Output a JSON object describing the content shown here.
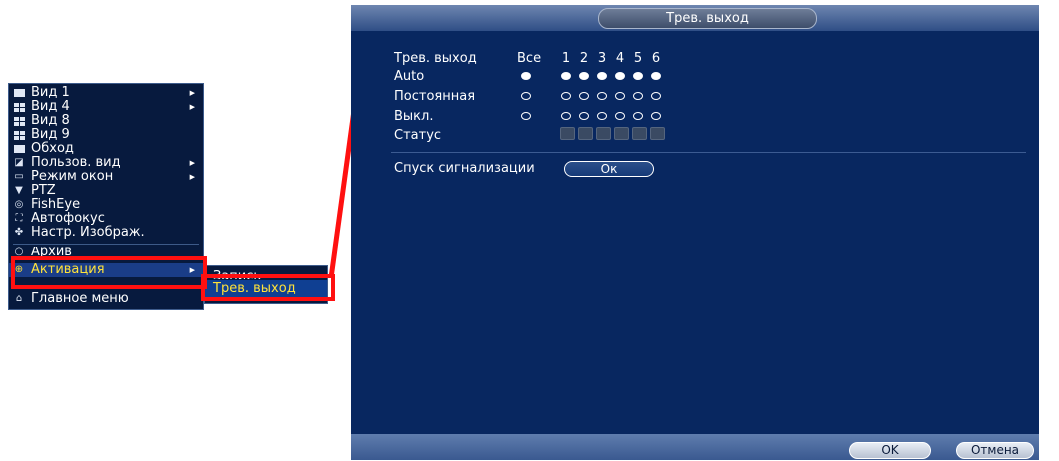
{
  "menu": {
    "items": [
      {
        "label": "Вид 1",
        "icon": "square-icon",
        "arrow": true
      },
      {
        "label": "Вид 4",
        "icon": "grid-4-icon",
        "arrow": true
      },
      {
        "label": "Вид 8",
        "icon": "grid-8-icon",
        "arrow": false
      },
      {
        "label": "Вид 9",
        "icon": "grid-9-icon",
        "arrow": false
      },
      {
        "label": "Обход",
        "icon": "tour-icon",
        "arrow": false
      },
      {
        "label": "Пользов. вид",
        "icon": "custom-view-icon",
        "arrow": true
      },
      {
        "label": "Режим окон",
        "icon": "monitor-icon",
        "arrow": true
      },
      {
        "label": "PTZ",
        "icon": "ptz-icon",
        "arrow": false
      },
      {
        "label": "FishEye",
        "icon": "fisheye-icon",
        "arrow": false
      },
      {
        "label": "Автофокус",
        "icon": "autofocus-icon",
        "arrow": false
      },
      {
        "label": "Настр. Изображ.",
        "icon": "image-settings-icon",
        "arrow": false
      },
      {
        "label": "Архив",
        "icon": "search-icon",
        "arrow": false
      },
      {
        "label": "Активация",
        "icon": "activation-icon",
        "arrow": true
      },
      {
        "label": "Главное меню",
        "icon": "home-icon",
        "arrow": false
      }
    ],
    "highlight_color": "#ffe23a"
  },
  "submenu": {
    "items": [
      "Запись",
      "Трев. выход"
    ],
    "selected": "Трев. выход"
  },
  "dialog": {
    "title": "Трев. выход",
    "header_label": "Трев. выход",
    "all_label": "Все",
    "channels": [
      "1",
      "2",
      "3",
      "4",
      "5",
      "6"
    ],
    "rows": [
      {
        "label": "Auto",
        "all_on": true,
        "states": [
          true,
          true,
          true,
          true,
          true,
          true
        ]
      },
      {
        "label": "Постоянная",
        "all_on": false,
        "states": [
          false,
          false,
          false,
          false,
          false,
          false
        ]
      },
      {
        "label": "Выкл.",
        "all_on": false,
        "states": [
          false,
          false,
          false,
          false,
          false,
          false
        ]
      }
    ],
    "status_label": "Статус",
    "alarm_release_label": "Спуск сигнализации",
    "alarm_release_button": "Ок",
    "ok_button": "OK",
    "cancel_button": "Отмена"
  },
  "colors": {
    "dialog_bg": "#082760",
    "menu_bg": "#071a3e",
    "annotation_red": "#ff1010"
  }
}
